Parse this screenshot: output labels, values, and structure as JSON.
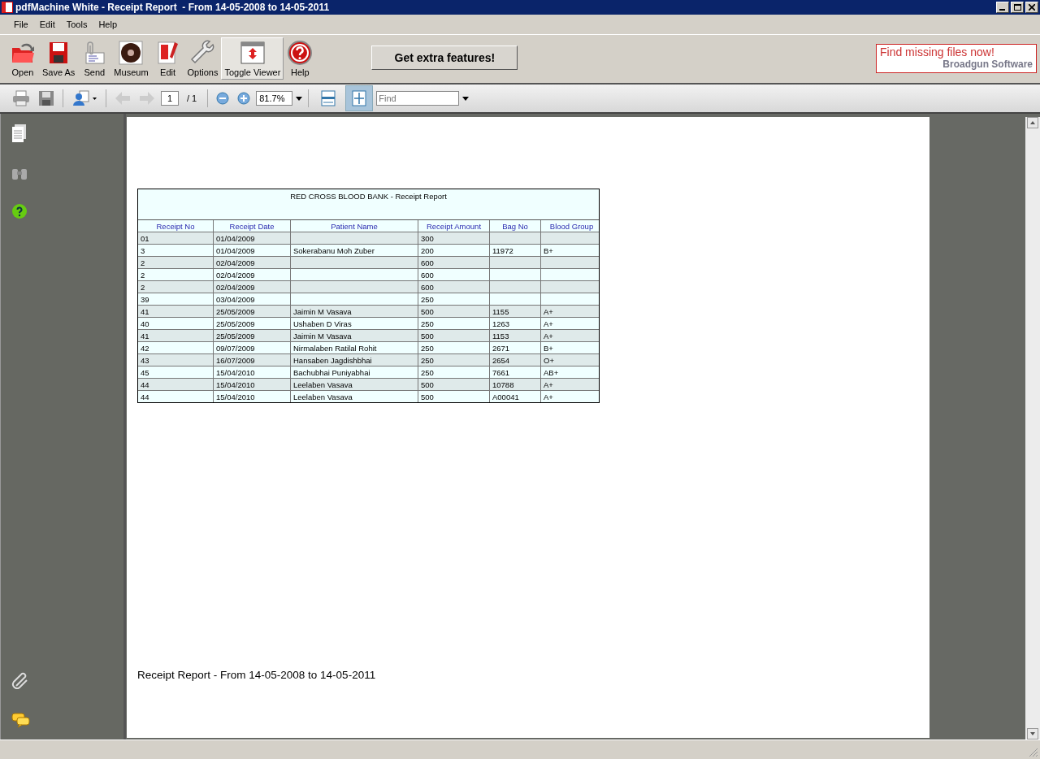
{
  "window": {
    "title": "pdfMachine White - Receipt Report  - From 14-05-2008 to 14-05-2011"
  },
  "menu": [
    "File",
    "Edit",
    "Tools",
    "Help"
  ],
  "toolbar": [
    {
      "kind": "open",
      "label": "Open",
      "selected": false
    },
    {
      "kind": "save",
      "label": "Save As",
      "selected": false
    },
    {
      "kind": "send",
      "label": "Send",
      "selected": false
    },
    {
      "kind": "museum",
      "label": "Museum",
      "selected": false
    },
    {
      "kind": "edit",
      "label": "Edit",
      "selected": false
    },
    {
      "kind": "options",
      "label": "Options",
      "selected": false
    },
    {
      "kind": "toggle",
      "label": "Toggle Viewer",
      "selected": true
    },
    {
      "kind": "help",
      "label": "Help",
      "selected": false
    }
  ],
  "extra_button": "Get extra features!",
  "ad": {
    "headline": "Find missing files now!",
    "brand": "Broadgun Software"
  },
  "viewer_toolbar": {
    "page": "1",
    "page_count": "/ 1",
    "zoom": "81.7%",
    "find_placeholder": "Find",
    "nav": [
      {
        "kind": "back",
        "disabled": true
      },
      {
        "kind": "forward",
        "disabled": true
      }
    ],
    "views": [
      {
        "kind": "fit-width",
        "selected": false
      },
      {
        "kind": "fit-page",
        "selected": true
      }
    ]
  },
  "document": {
    "report_title": "RED CROSS BLOOD BANK - Receipt Report",
    "columns": [
      "Receipt No",
      "Receipt Date",
      "Patient Name",
      "Receipt Amount",
      "Bag No",
      "Blood Group"
    ],
    "rows": [
      [
        "01",
        "01/04/2009",
        "",
        "300",
        "",
        ""
      ],
      [
        "3",
        "01/04/2009",
        "Sokerabanu Moh Zuber",
        "200",
        "11972",
        "B+"
      ],
      [
        "2",
        "02/04/2009",
        "",
        "600",
        "",
        ""
      ],
      [
        "2",
        "02/04/2009",
        "",
        "600",
        "",
        ""
      ],
      [
        "2",
        "02/04/2009",
        "",
        "600",
        "",
        ""
      ],
      [
        "39",
        "03/04/2009",
        "",
        "250",
        "",
        ""
      ],
      [
        "41",
        "25/05/2009",
        "Jaimin M Vasava",
        "500",
        "1155",
        "A+"
      ],
      [
        "40",
        "25/05/2009",
        "Ushaben D Viras",
        "250",
        "1263",
        "A+"
      ],
      [
        "41",
        "25/05/2009",
        "Jaimin M Vasava",
        "500",
        "1153",
        "A+"
      ],
      [
        "42",
        "09/07/2009",
        "Nirmalaben Ratilal Rohit",
        "250",
        "2671",
        "B+"
      ],
      [
        "43",
        "16/07/2009",
        "Hansaben Jagdishbhai",
        "250",
        "2654",
        "O+"
      ],
      [
        "45",
        "15/04/2010",
        "Bachubhai Puniyabhai",
        "250",
        "7661",
        "AB+"
      ],
      [
        "44",
        "15/04/2010",
        "Leelaben Vasava",
        "500",
        "10788",
        "A+"
      ],
      [
        "44",
        "15/04/2010",
        "Leelaben Vasava",
        "500",
        "A00041",
        "A+"
      ]
    ],
    "footer": "Receipt Report  - From 14-05-2008 to 14-05-2011"
  }
}
